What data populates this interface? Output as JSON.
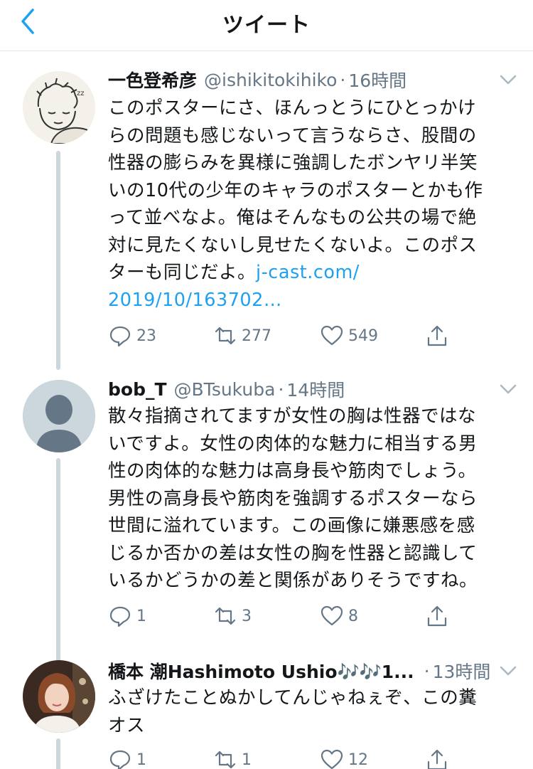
{
  "nav": {
    "title": "ツイート"
  },
  "tweets": [
    {
      "name": "一色登希彦",
      "handle": "@ishikitokihiko",
      "separator": "·",
      "time": "16時間",
      "lines": [
        "このポスターにさ、ほんっとうにひとっかけ",
        "らの問題も感じないって言うならさ、股間の",
        "性器の膨らみを異様に強調したボンヤリ半笑",
        "いの10代の少年のキャラのポスターとかも作",
        "って並べなよ。俺はそんなもの公共の場で絶",
        "対に見たくないし見せたくないよ。このポス"
      ],
      "last_line_prefix": "ターも同じだよ。",
      "link_part1": "j-cast.com/",
      "link_part2": "2019/10/163702…",
      "replies": "23",
      "retweets": "277",
      "likes": "549"
    },
    {
      "name": "bob_T",
      "handle": "@BTsukuba",
      "separator": "·",
      "time": "14時間",
      "lines": [
        "散々指摘されてますが女性の胸は性器ではな",
        "いですよ。女性の肉体的な魅力に相当する男",
        "性の肉体的な魅力は高身長や筋肉でしょう。",
        "男性の高身長や筋肉を強調するポスターなら",
        "世間に溢れています。この画像に嫌悪感を感",
        "じるか否かの差は女性の胸を性器と認識して",
        "いるかどうかの差と関係がありそうですね。"
      ],
      "replies": "1",
      "retweets": "3",
      "likes": "8"
    },
    {
      "name": "橋本 潮Hashimoto Ushio🎶🎶1...",
      "separator": "·",
      "time": "13時間",
      "lines": [
        "ふざけたことぬかしてんじゃねぇぞ、この糞",
        "オス"
      ],
      "replies": "1",
      "retweets": "1",
      "likes": "12"
    }
  ],
  "colors": {
    "accent": "#1da1f2",
    "text": "#14171a",
    "muted": "#657786",
    "line": "#ccd6dd"
  },
  "icons": [
    "back-arrow-icon",
    "chevron-down-icon",
    "reply-icon",
    "retweet-icon",
    "like-heart-icon",
    "share-icon"
  ]
}
